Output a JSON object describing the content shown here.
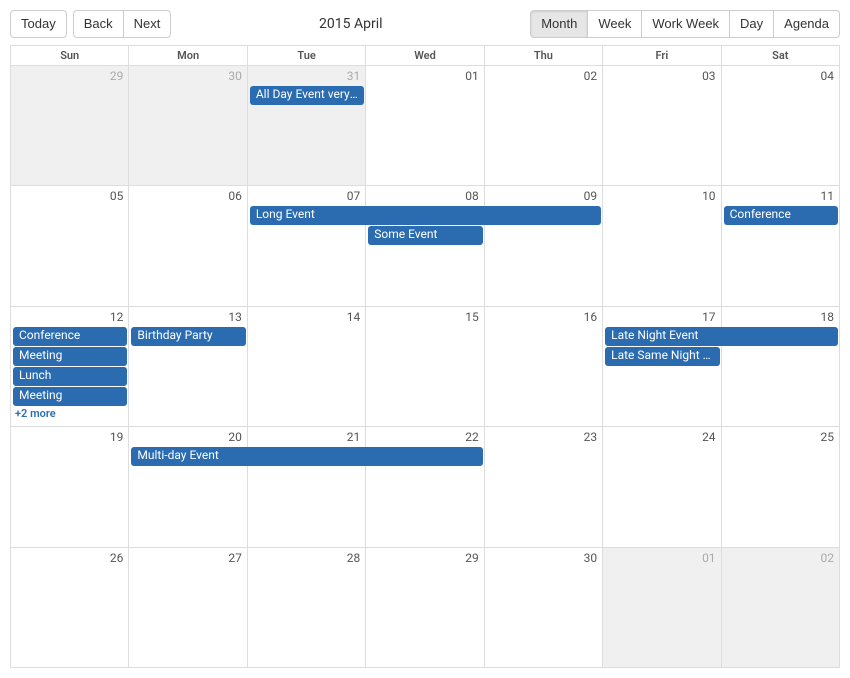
{
  "toolbar": {
    "today": "Today",
    "back": "Back",
    "next": "Next",
    "title": "2015 April",
    "views": {
      "month": "Month",
      "week": "Week",
      "work_week": "Work Week",
      "day": "Day",
      "agenda": "Agenda"
    },
    "active_view": "month"
  },
  "dow": [
    "Sun",
    "Mon",
    "Tue",
    "Wed",
    "Thu",
    "Fri",
    "Sat"
  ],
  "weeks": [
    {
      "days": [
        {
          "n": "29",
          "off": true
        },
        {
          "n": "30",
          "off": true
        },
        {
          "n": "31",
          "off": true
        },
        {
          "n": "01"
        },
        {
          "n": "02"
        },
        {
          "n": "03"
        },
        {
          "n": "04"
        }
      ],
      "events": [
        {
          "col": 3,
          "span": 1,
          "row": 1,
          "label": "All Day Event very lo…"
        }
      ]
    },
    {
      "days": [
        {
          "n": "05"
        },
        {
          "n": "06"
        },
        {
          "n": "07"
        },
        {
          "n": "08"
        },
        {
          "n": "09"
        },
        {
          "n": "10"
        },
        {
          "n": "11"
        }
      ],
      "events": [
        {
          "col": 3,
          "span": 3,
          "row": 1,
          "label": "Long Event"
        },
        {
          "col": 7,
          "span": 1,
          "row": 1,
          "label": "Conference"
        },
        {
          "col": 4,
          "span": 1,
          "row": 2,
          "label": "Some Event"
        }
      ]
    },
    {
      "days": [
        {
          "n": "12"
        },
        {
          "n": "13"
        },
        {
          "n": "14"
        },
        {
          "n": "15"
        },
        {
          "n": "16"
        },
        {
          "n": "17"
        },
        {
          "n": "18"
        }
      ],
      "events": [
        {
          "col": 1,
          "span": 1,
          "row": 1,
          "label": "Conference"
        },
        {
          "col": 2,
          "span": 1,
          "row": 1,
          "label": "Birthday Party"
        },
        {
          "col": 6,
          "span": 2,
          "row": 1,
          "label": "Late Night Event"
        },
        {
          "col": 1,
          "span": 1,
          "row": 2,
          "label": "Meeting"
        },
        {
          "col": 6,
          "span": 1,
          "row": 2,
          "label": "Late Same Night Event"
        },
        {
          "col": 1,
          "span": 1,
          "row": 3,
          "label": "Lunch"
        },
        {
          "col": 1,
          "span": 1,
          "row": 4,
          "label": "Meeting"
        },
        {
          "col": 1,
          "span": 1,
          "row": 5,
          "more": true,
          "label": "+2 more"
        }
      ]
    },
    {
      "days": [
        {
          "n": "19"
        },
        {
          "n": "20"
        },
        {
          "n": "21"
        },
        {
          "n": "22"
        },
        {
          "n": "23"
        },
        {
          "n": "24"
        },
        {
          "n": "25"
        }
      ],
      "events": [
        {
          "col": 2,
          "span": 3,
          "row": 1,
          "label": "Multi-day Event"
        }
      ]
    },
    {
      "days": [
        {
          "n": "26"
        },
        {
          "n": "27"
        },
        {
          "n": "28"
        },
        {
          "n": "29"
        },
        {
          "n": "30"
        },
        {
          "n": "01",
          "off": true
        },
        {
          "n": "02",
          "off": true
        }
      ],
      "events": []
    },
    {
      "days": [],
      "events": []
    }
  ]
}
